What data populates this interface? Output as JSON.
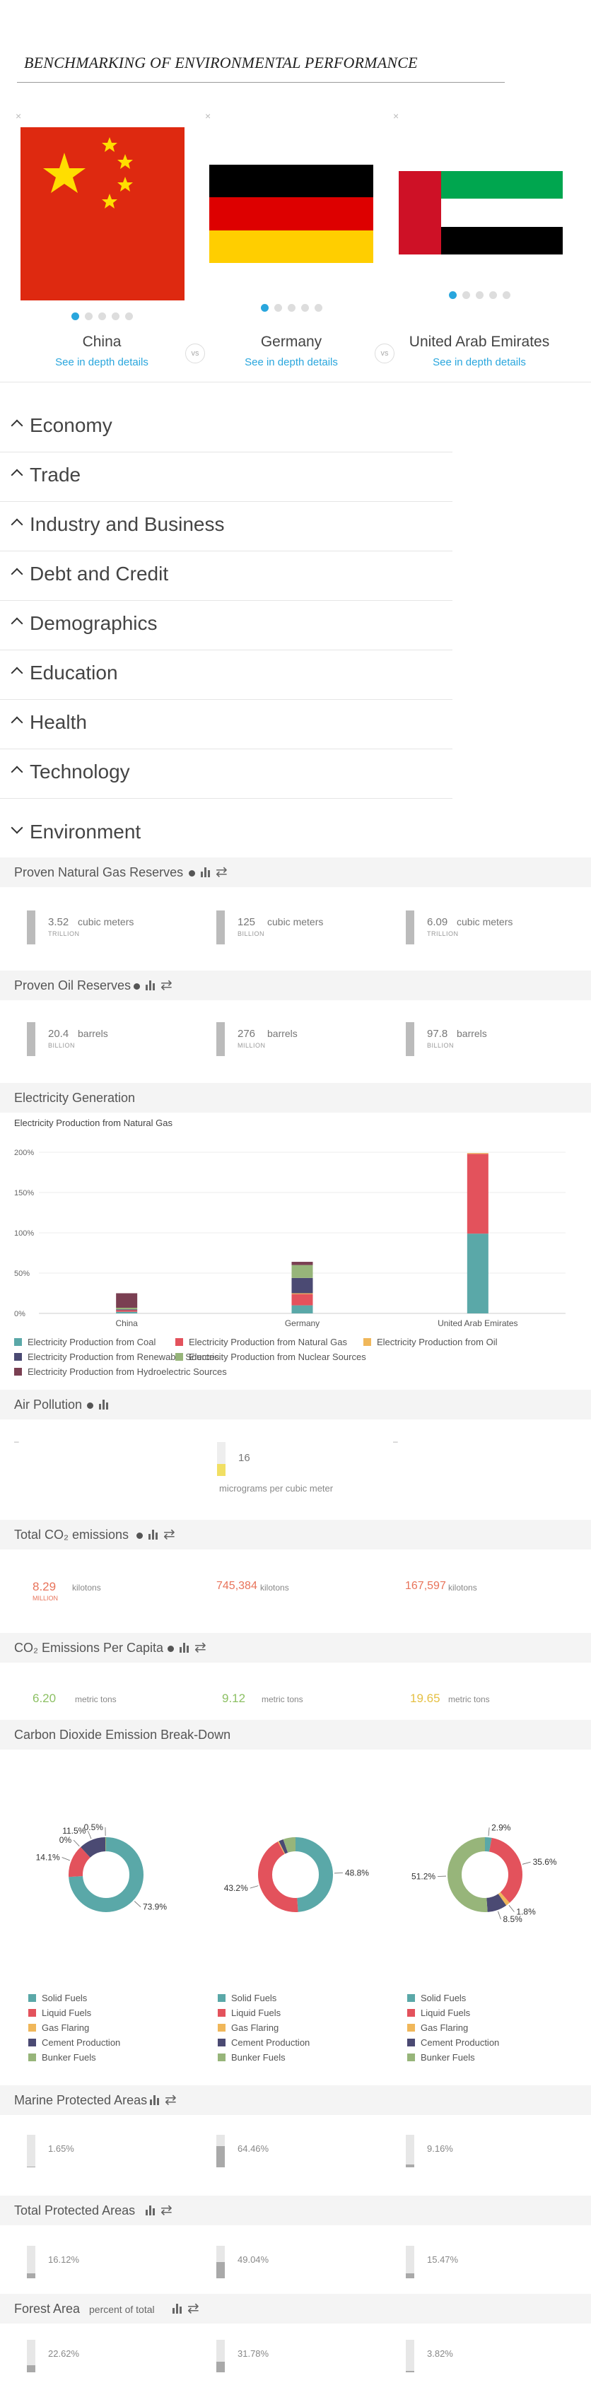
{
  "page_title": "BENCHMARKING OF ENVIRONMENTAL PERFORMANCE",
  "close_glyph": "×",
  "vs_label": "vs",
  "countries": [
    {
      "name": "China",
      "link": "See in depth details"
    },
    {
      "name": "Germany",
      "link": "See in depth details"
    },
    {
      "name": "United Arab Emirates",
      "link": "See in depth details"
    }
  ],
  "accordion": [
    {
      "label": "Economy",
      "expanded": false
    },
    {
      "label": "Trade",
      "expanded": false
    },
    {
      "label": "Industry and Business",
      "expanded": false
    },
    {
      "label": "Debt and Credit",
      "expanded": false
    },
    {
      "label": "Demographics",
      "expanded": false
    },
    {
      "label": "Education",
      "expanded": false
    },
    {
      "label": "Health",
      "expanded": false
    },
    {
      "label": "Technology",
      "expanded": false
    },
    {
      "label": "Environment",
      "expanded": true
    }
  ],
  "gas": {
    "label": "Proven Natural Gas Reserves",
    "cells": [
      {
        "value": "3.52",
        "unit": "cubic meters",
        "mult": "TRILLION"
      },
      {
        "value": "125",
        "unit": "cubic meters",
        "mult": "BILLION"
      },
      {
        "value": "6.09",
        "unit": "cubic meters",
        "mult": "TRILLION"
      }
    ]
  },
  "oil": {
    "label": "Proven Oil Reserves",
    "cells": [
      {
        "value": "20.4",
        "unit": "barrels",
        "mult": "BILLION"
      },
      {
        "value": "276",
        "unit": "barrels",
        "mult": "MILLION"
      },
      {
        "value": "97.8",
        "unit": "barrels",
        "mult": "BILLION"
      }
    ]
  },
  "electricity": {
    "label": "Electricity Generation",
    "subtitle": "Electricity Production from Natural Gas"
  },
  "air": {
    "label": "Air Pollution",
    "placeholder_left": "–",
    "placeholder_right": "–",
    "value": "16",
    "unit": "micrograms per cubic meter",
    "level": 0.35
  },
  "total_co2": {
    "label": "Total CO₂ emissions",
    "cells": [
      {
        "value": "8.29",
        "mult": "MILLION",
        "unit": "kilotons",
        "color": "#e8735a"
      },
      {
        "value": "745,384",
        "unit": "kilotons",
        "color": "#e8735a"
      },
      {
        "value": "167,597",
        "unit": "kilotons",
        "color": "#e8735a"
      }
    ]
  },
  "co2_capita": {
    "label": "CO₂ Emissions Per Capita",
    "cells": [
      {
        "value": "6.20",
        "unit": "metric tons",
        "color": "#8cc063"
      },
      {
        "value": "9.12",
        "unit": "metric tons",
        "color": "#8cc063"
      },
      {
        "value": "19.65",
        "unit": "metric tons",
        "color": "#e5c043"
      }
    ]
  },
  "breakdown": {
    "label": "Carbon Dioxide Emission Break-Down",
    "legend": [
      "Solid Fuels",
      "Liquid Fuels",
      "Gas Flaring",
      "Cement Production",
      "Bunker Fuels"
    ],
    "colors": [
      "#5aa8a8",
      "#e3525c",
      "#f0b75a",
      "#4b4a73",
      "#97b57a"
    ]
  },
  "marine": {
    "label": "Marine Protected Areas",
    "values": [
      "1.65%",
      "64.46%",
      "9.16%"
    ],
    "levels": [
      0.0165,
      0.6446,
      0.0916
    ]
  },
  "protected": {
    "label": "Total Protected Areas",
    "values": [
      "16.12%",
      "49.04%",
      "15.47%"
    ],
    "levels": [
      0.1612,
      0.4904,
      0.1547
    ]
  },
  "forest": {
    "label": "Forest Area",
    "sublabel": "percent of total",
    "values": [
      "22.62%",
      "31.78%",
      "3.82%"
    ],
    "levels": [
      0.2262,
      0.3178,
      0.0382
    ]
  },
  "chart_data": [
    {
      "type": "bar",
      "stacked": true,
      "title": "Electricity Production from Natural Gas",
      "categories": [
        "China",
        "Germany",
        "United Arab Emirates"
      ],
      "yticks": [
        "200%",
        "150%",
        "100%",
        "50%",
        "0%"
      ],
      "ylim": [
        0,
        200
      ],
      "series": [
        {
          "name": "Electricity Production from Coal",
          "color": "#5aa8a8",
          "values": [
            2,
            10,
            99
          ]
        },
        {
          "name": "Electricity Production from Natural Gas",
          "color": "#e3525c",
          "values": [
            2,
            14,
            99
          ]
        },
        {
          "name": "Electricity Production from Oil",
          "color": "#f0b75a",
          "values": [
            0,
            1,
            1
          ]
        },
        {
          "name": "Electricity Production from Renewable Sources",
          "color": "#4b4a73",
          "values": [
            1,
            19,
            0
          ]
        },
        {
          "name": "Electricity Production from Nuclear Sources",
          "color": "#97b57a",
          "values": [
            2,
            16,
            0
          ]
        },
        {
          "name": "Electricity Production from Hydroelectric Sources",
          "color": "#7a3f52",
          "values": [
            18,
            4,
            0
          ]
        }
      ],
      "legend_position": "bottom"
    },
    {
      "type": "pie",
      "donut": true,
      "labels": [
        "Solid Fuels",
        "Liquid Fuels",
        "Gas Flaring",
        "Cement Production",
        "Bunker Fuels"
      ],
      "charts": [
        {
          "country": "China",
          "values": [
            73.9,
            14.1,
            0,
            11.5,
            0.5
          ],
          "labels": [
            "73.9%",
            "14.1%",
            "0%",
            "11.5%",
            "0.5%"
          ]
        },
        {
          "country": "Germany",
          "values": [
            48.8,
            43.2,
            0.5,
            2,
            5.5
          ],
          "labels": [
            "48.8%",
            "43.2%",
            "",
            "",
            ""
          ]
        },
        {
          "country": "United Arab Emirates",
          "values": [
            2.9,
            35.6,
            1.8,
            8.5,
            51.2
          ],
          "labels": [
            "2.9%",
            "35.6%",
            "1.8%",
            "8.5%",
            "51.2%"
          ]
        }
      ]
    }
  ]
}
